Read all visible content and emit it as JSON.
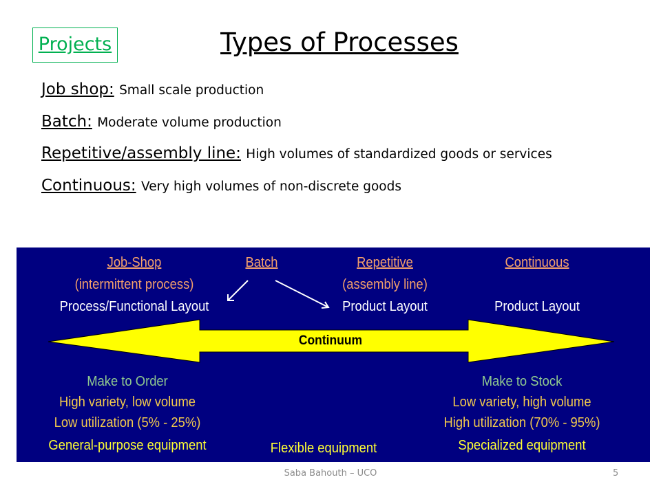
{
  "slide": {
    "nav_link": "Projects",
    "title": "Types of Processes",
    "definitions": [
      {
        "term": "Job shop:",
        "description": "Small scale production"
      },
      {
        "term": "Batch:",
        "description": "Moderate volume production"
      },
      {
        "term": "Repetitive/assembly line:",
        "description": "High volumes of standardized goods or services"
      },
      {
        "term": "Continuous:",
        "description": "Very high volumes of non-discrete goods"
      }
    ]
  },
  "diagram": {
    "columns": [
      {
        "name": "Job-Shop",
        "subtitle": "(intermittent process)",
        "layout": "Process/Functional Layout"
      },
      {
        "name": "Batch"
      },
      {
        "name": "Repetitive",
        "subtitle": "(assembly line)",
        "layout": "Product Layout"
      },
      {
        "name": "Continuous",
        "layout": "Product Layout"
      }
    ],
    "continuum_label": "Continuum",
    "left_end": {
      "heading": "Make to Order",
      "line1": "High variety, low volume",
      "line2": "Low utilization (5% - 25%)",
      "equipment": "General-purpose equipment"
    },
    "middle_equipment": "Flexible equipment",
    "right_end": {
      "heading": "Make to Stock",
      "line1": "Low variety, high volume",
      "line2": "High utilization (70% - 95%)",
      "equipment": "Specialized equipment"
    },
    "colors": {
      "background": "#000080",
      "arrow": "#FFFF00",
      "process_name": "#F4A06B",
      "heading": "#8FC98F",
      "detail": "#F2C94C",
      "equipment": "#FFFF33"
    }
  },
  "footer": {
    "author": "Saba Bahouth – UCO",
    "page_number": "5"
  }
}
